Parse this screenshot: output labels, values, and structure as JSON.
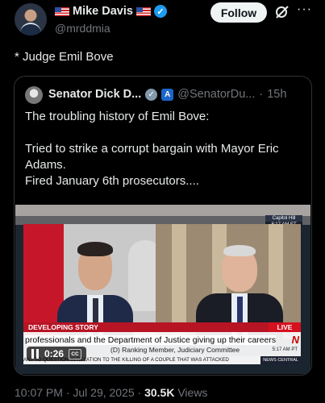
{
  "author": {
    "name": "Mike Davis",
    "handle": "@mrddmia"
  },
  "follow_label": "Follow",
  "post_text": "* Judge Emil Bove",
  "quoted": {
    "name": "Senator Dick D...",
    "handle": "@SenatorDu...",
    "separator": "·",
    "time": "15h",
    "lines": [
      "The troubling history of Emil Bove:",
      "Tried to strike a corrupt bargain with Mayor Eric Adams.\nFired January 6th prosecutors...."
    ]
  },
  "video": {
    "location": "Capitol Hill",
    "clock": "8:17 AM ET",
    "banner": "DEVELOPING STORY",
    "live": "LIVE",
    "caption": "professionals and the Department of Justice giving up their careers",
    "subtitle": "(D) Ranking Member, Judiciary Committee",
    "subtime": "5:17 AM PT",
    "ticker": "ANT TO QUESTION IN RELATION TO THE KILLING OF A COUPLE THAT WAS ATTACKED",
    "ticker_tag": "NEWS CENTRAL",
    "elapsed": "0:26",
    "cc": "CC"
  },
  "meta": {
    "time": "10:07 PM · Jul 29, 2025 · ",
    "views": "30.5K",
    "views_label": " Views"
  }
}
